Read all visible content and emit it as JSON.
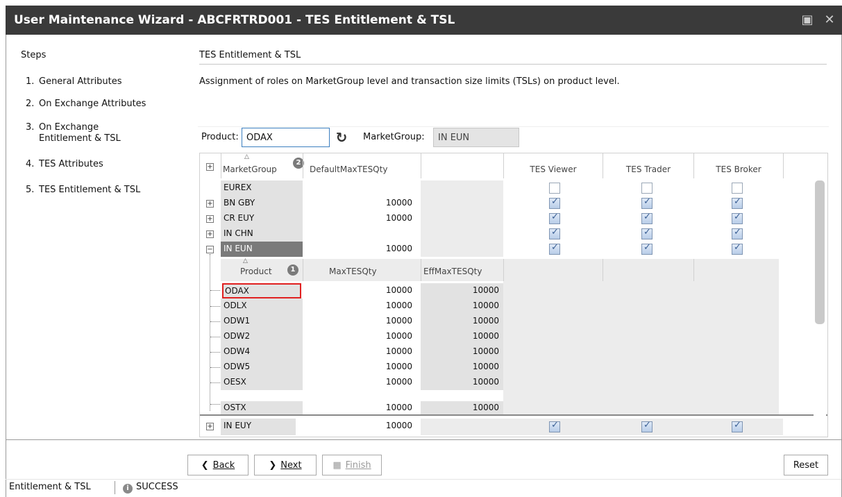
{
  "window": {
    "title": "User Maintenance Wizard  - ABCFRTRD001 - TES Entitlement & TSL"
  },
  "steps": {
    "title": "Steps",
    "items": [
      {
        "num": "1.",
        "label": "General Attributes"
      },
      {
        "num": "2.",
        "label": "On Exchange Attributes"
      },
      {
        "num": "3.",
        "label": "On Exchange Entitlement & TSL"
      },
      {
        "num": "4.",
        "label": "TES Attributes"
      },
      {
        "num": "5.",
        "label": "TES Entitlement & TSL"
      }
    ]
  },
  "section": {
    "title": "TES Entitlement & TSL",
    "description": "Assignment of roles on MarketGroup level and transaction size limits (TSLs) on product level."
  },
  "filter": {
    "product_label": "Product:",
    "product_value": "ODAX",
    "marketgroup_label": "MarketGroup:",
    "marketgroup_value": "IN EUN"
  },
  "grid": {
    "headers": {
      "expand": "+",
      "marketgroup": "MarketGroup",
      "marketgroup_badge": "2",
      "default_max": "DefaultMaxTESQty",
      "tes_viewer": "TES Viewer",
      "tes_trader": "TES Trader",
      "tes_broker": "TES Broker"
    },
    "rows": [
      {
        "name": "EUREX",
        "qty": "",
        "expander": "",
        "viewer": false,
        "trader": false,
        "broker": false
      },
      {
        "name": "BN GBY",
        "qty": "10000",
        "expander": "+",
        "viewer": true,
        "trader": true,
        "broker": true
      },
      {
        "name": "CR EUY",
        "qty": "10000",
        "expander": "+",
        "viewer": true,
        "trader": true,
        "broker": true
      },
      {
        "name": "IN CHN",
        "qty": "",
        "expander": "+",
        "viewer": true,
        "trader": true,
        "broker": true
      },
      {
        "name": "IN EUN",
        "qty": "10000",
        "expander": "−",
        "viewer": true,
        "trader": true,
        "broker": true
      }
    ],
    "subgrid": {
      "headers": {
        "product": "Product",
        "product_badge": "1",
        "max": "MaxTESQty",
        "eff": "EffMaxTESQty"
      },
      "rows": [
        {
          "product": "ODAX",
          "max": "10000",
          "eff": "10000"
        },
        {
          "product": "ODLX",
          "max": "10000",
          "eff": "10000"
        },
        {
          "product": "ODW1",
          "max": "10000",
          "eff": "10000"
        },
        {
          "product": "ODW2",
          "max": "10000",
          "eff": "10000"
        },
        {
          "product": "ODW4",
          "max": "10000",
          "eff": "10000"
        },
        {
          "product": "ODW5",
          "max": "10000",
          "eff": "10000"
        },
        {
          "product": "OESX",
          "max": "10000",
          "eff": "10000"
        },
        {
          "product": "OSTX",
          "max": "10000",
          "eff": "10000"
        }
      ]
    },
    "last_row": {
      "name": "IN EUY",
      "qty": "10000",
      "expander": "+",
      "viewer": true,
      "trader": true,
      "broker": true
    }
  },
  "buttons": {
    "back": "Back",
    "next": "Next",
    "finish": "Finish",
    "reset": "Reset"
  },
  "status": {
    "left": "Entitlement & TSL",
    "right": "SUCCESS"
  }
}
